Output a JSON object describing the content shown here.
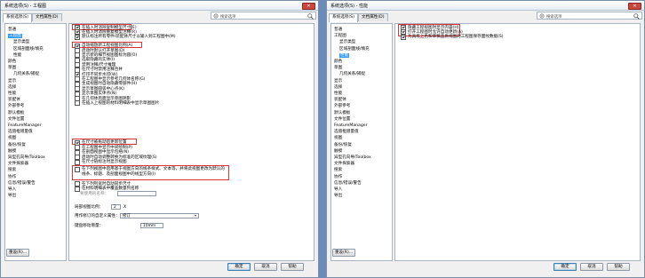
{
  "left_dialog": {
    "title": "系统选项(S) - 工程图",
    "close": "✕",
    "tabs": [
      "系统选项(S)",
      "文档属性(D)"
    ],
    "search_placeholder": "搜索选项",
    "tree": [
      "普通",
      "工程图",
      "显示类型",
      "区域剖面线/填充",
      "性能",
      "颜色",
      "草图",
      "几何关系/捕捉",
      "显示",
      "选择",
      "性能",
      "装配体",
      "外部参考",
      "默认模板",
      "文件位置",
      "FeatureManager",
      "选值框增量值",
      "视图",
      "备份/恢复",
      "触摸",
      "异型孔向导/Toolbox",
      "文件探索器",
      "搜索",
      "协作",
      "信息/错误/警告",
      "导入",
      "导出"
    ],
    "options": [
      {
        "text": "在插入时消除复制模型尺寸(E)",
        "checked": true
      },
      {
        "text": "在插入时消除重复模型注释(R)",
        "checked": true
      },
      {
        "text": "默认标注所有零件/装配体尺寸以输入到工程图中(M)",
        "checked": true
      },
      {
        "text": "自动缩放新工程视图比例(A)",
        "checked": true
      },
      {
        "text": "启动时默认打开草图(D)",
        "checked": false
      },
      {
        "text": "显示新的细节视图图标为圆(O)",
        "checked": false
      },
      {
        "text": "选取隐藏的实体(I)",
        "checked": false
      },
      {
        "text": "禁用注释/尺寸推理",
        "checked": false
      },
      {
        "text": "在尺寸时禁用注释合并",
        "checked": false
      },
      {
        "text": "打印不同步水印(W)",
        "checked": true
      },
      {
        "text": "在工程图中显示参考几何体名称(G)",
        "checked": false
      },
      {
        "text": "生成视图时自动隐藏零部件(H)",
        "checked": false
      },
      {
        "text": "显示草图圆弧中心点(K)",
        "checked": false
      },
      {
        "text": "显示草图实体点(N)",
        "checked": false
      },
      {
        "text": "在几何体后面显示草图阴影",
        "checked": false
      },
      {
        "text": "在插入上视图的材料明细表中显示草图图片",
        "checked": false
      },
      {
        "text": "在尺寸被拖动后更新位置",
        "checked": true
      },
      {
        "text": "在工程图中显示中间绘制(P)",
        "checked": false
      },
      {
        "text": "在剖面视图中显示包络(N)",
        "checked": false
      },
      {
        "text": "启动时自动调整转换为标准的区域纹理(S)",
        "checked": false
      },
      {
        "text": "在尺寸链标注时显示视图",
        "checked": false
      },
      {
        "text": "在下列列宽时自动同步尺寸",
        "checked": false
      },
      {
        "text": "在材料明细表中覆盖数量列名称",
        "checked": false
      }
    ],
    "highlighted_option": "在下列视图中启用基于视图方向的线条样式、文本等，并将此视图更改为默认的线条、标题、及剖面视图中的线型方向(I)",
    "quantity_label": "要使用的名称：",
    "spin_label": "局部视图比例：",
    "spin_value": "2",
    "spin_unit": "X",
    "bom_label": "用作修订的自定义属性：",
    "bom_value": "修订",
    "keyboard_label": "键盘移动增量：",
    "keyboard_value": "10mm",
    "reset_button": "重设(R)...",
    "ok": "确定",
    "cancel": "取消",
    "help": "帮助"
  },
  "right_dialog": {
    "title": "系统选项(S) - 性能",
    "close": "✕",
    "tabs": [
      "系统选项(S)",
      "文档属性(D)"
    ],
    "search_placeholder": "搜索选项",
    "tree": [
      "普通",
      "工程图",
      "显示类型",
      "区域剖面线/填充",
      "性能",
      "颜色",
      "草图",
      "几何关系/捕捉",
      "显示",
      "选择",
      "性能",
      "装配体",
      "外部参考",
      "默认模板",
      "文件位置",
      "FeatureManager",
      "选值框增量值",
      "视图",
      "备份/恢复",
      "触摸",
      "异型孔向导/Toolbox",
      "文件探索器",
      "搜索",
      "协作",
      "信息/错误/警告",
      "导入",
      "导出"
    ],
    "options": [
      {
        "text": "隐藏工程视图时显示内容(H)",
        "checked": true
      },
      {
        "text": "打开工程图时允许自动更新(A)",
        "checked": true
      },
      {
        "text": "为具有上色和草稿品质视图的工程图保存面纹数据(S)",
        "checked": true
      }
    ],
    "reset_button": "重设(R)...",
    "ok": "确定",
    "cancel": "取消",
    "help": "帮助"
  },
  "colors": {
    "highlight": "#e0303a",
    "selection": "#3399ff",
    "background": "#6b8cba"
  }
}
